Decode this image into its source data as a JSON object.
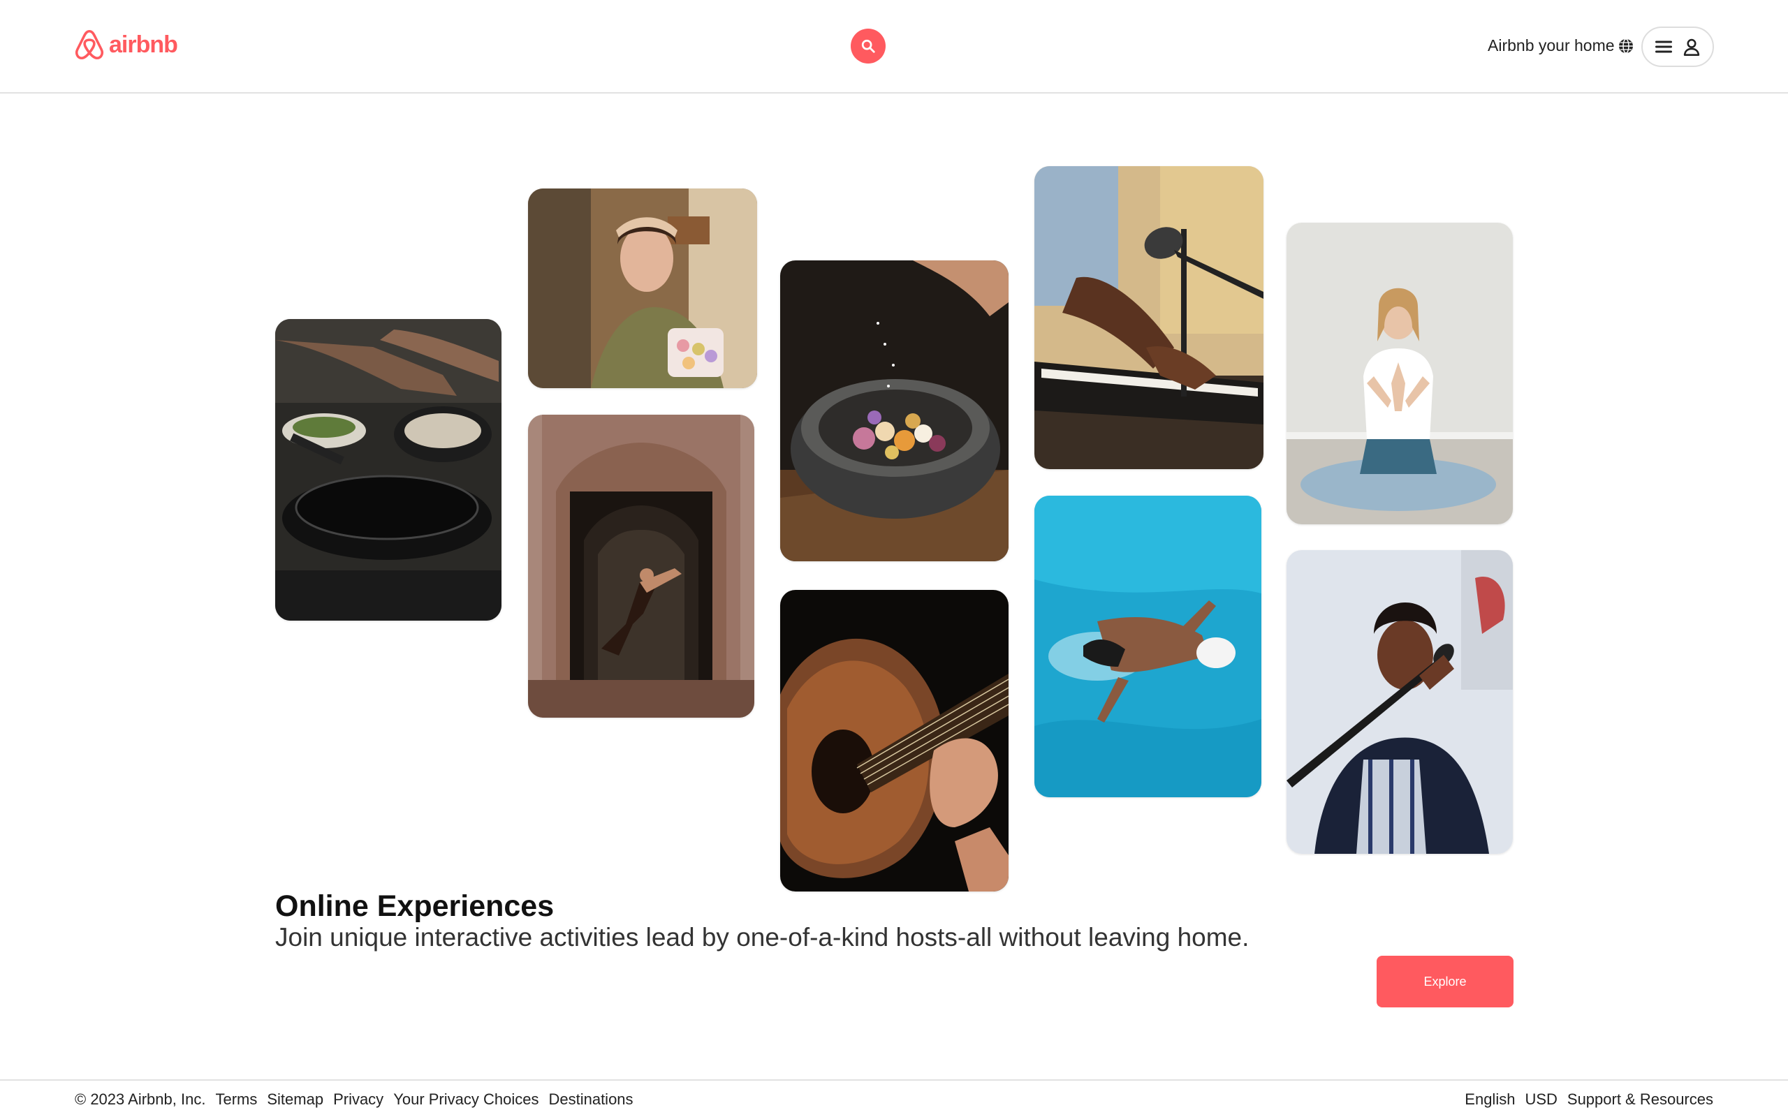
{
  "header": {
    "brand": "airbnb",
    "host_link": "Airbnb your home",
    "icons": [
      "airbnb-logo-icon",
      "search-icon",
      "globe-icon",
      "hamburger-menu-icon",
      "user-icon"
    ]
  },
  "colors": {
    "brand": "#ff5a5f",
    "text": "#222222",
    "border": "#dddddd"
  },
  "gallery": {
    "photos": [
      {
        "name": "photo-cooking-pan",
        "subject": "hands cooking with frying pan"
      },
      {
        "name": "photo-woman-macarons",
        "subject": "woman holding box of macarons"
      },
      {
        "name": "photo-dancer-archway",
        "subject": "dancer leaping in ornate archway"
      },
      {
        "name": "photo-stone-bowl",
        "subject": "seasoning food in stone bowl"
      },
      {
        "name": "photo-acoustic-guitar",
        "subject": "hands playing acoustic guitar"
      },
      {
        "name": "photo-piano-microphone",
        "subject": "hands on keyboard with microphone"
      },
      {
        "name": "photo-swimmer-pool",
        "subject": "swimmer in blue pool"
      },
      {
        "name": "photo-yoga-meditation",
        "subject": "woman meditating in yoga pose"
      },
      {
        "name": "photo-singer-microphone",
        "subject": "singer performing at microphone"
      }
    ]
  },
  "hero": {
    "title": "Online Experiences",
    "subtitle": "Join unique interactive activities lead by one-of-a-kind hosts-all without leaving home.",
    "cta": "Explore"
  },
  "footer": {
    "copyright": "© 2023 Airbnb, Inc.",
    "links": [
      "Terms",
      "Sitemap",
      "Privacy",
      "Your Privacy Choices",
      "Destinations"
    ],
    "language": "English",
    "currency": "USD",
    "support": "Support & Resources"
  }
}
